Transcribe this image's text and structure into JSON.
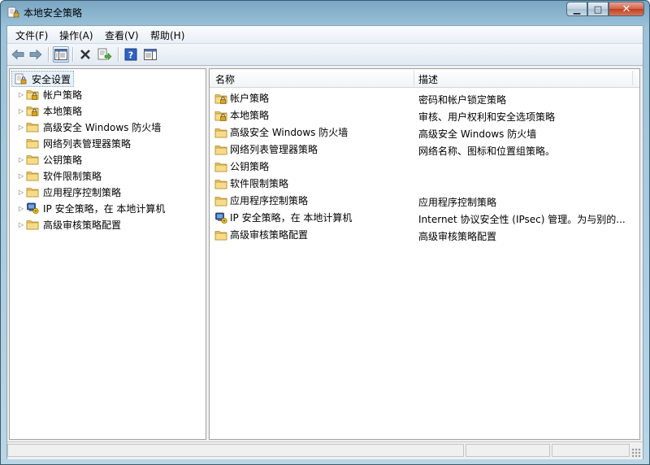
{
  "window": {
    "title": "本地安全策略"
  },
  "menu": [
    {
      "label": "文件(F)"
    },
    {
      "label": "操作(A)"
    },
    {
      "label": "查看(V)"
    },
    {
      "label": "帮助(H)"
    }
  ],
  "toolbar": {
    "icons": [
      "back-arrow-icon",
      "forward-arrow-icon",
      "show-hide-tree-icon",
      "delete-icon",
      "export-list-icon",
      "help-icon",
      "properties-icon"
    ]
  },
  "tree": {
    "root": "安全设置",
    "items": [
      {
        "label": "帐户策略",
        "icon": "folder-lock"
      },
      {
        "label": "本地策略",
        "icon": "folder-lock"
      },
      {
        "label": "高级安全 Windows 防火墙",
        "icon": "folder"
      },
      {
        "label": "网络列表管理器策略",
        "icon": "folder"
      },
      {
        "label": "公钥策略",
        "icon": "folder"
      },
      {
        "label": "软件限制策略",
        "icon": "folder"
      },
      {
        "label": "应用程序控制策略",
        "icon": "folder"
      },
      {
        "label": "IP 安全策略，在 本地计算机",
        "icon": "ipsec"
      },
      {
        "label": "高级审核策略配置",
        "icon": "folder"
      }
    ]
  },
  "list": {
    "columns": [
      "名称",
      "描述"
    ],
    "rows": [
      {
        "name": "帐户策略",
        "desc": "密码和帐户锁定策略"
      },
      {
        "name": "本地策略",
        "desc": "审核、用户权利和安全选项策略"
      },
      {
        "name": "高级安全 Windows 防火墙",
        "desc": "高级安全 Windows 防火墙"
      },
      {
        "name": "网络列表管理器策略",
        "desc": "网络名称、图标和位置组策略。"
      },
      {
        "name": "公钥策略",
        "desc": ""
      },
      {
        "name": "软件限制策略",
        "desc": ""
      },
      {
        "name": "应用程序控制策略",
        "desc": "应用程序控制策略"
      },
      {
        "name": "IP 安全策略，在 本地计算机",
        "desc": "Internet 协议安全性 (IPsec) 管理。为与别的..."
      },
      {
        "name": "高级审核策略配置",
        "desc": "高级审核策略配置"
      }
    ]
  }
}
